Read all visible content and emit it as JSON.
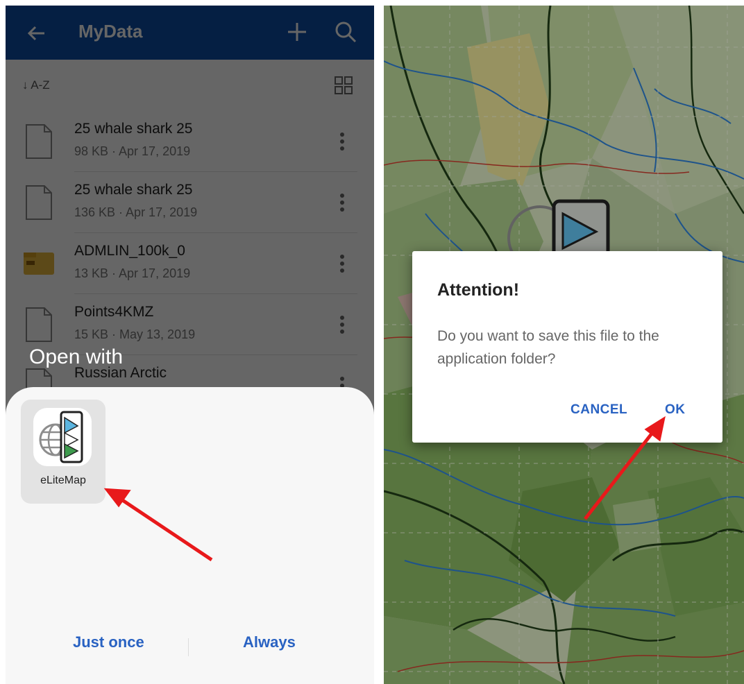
{
  "left": {
    "appbar": {
      "title": "MyData"
    },
    "sort": {
      "label": "A-Z"
    },
    "files": [
      {
        "name": "25 whale shark 25",
        "meta": "98 KB · Apr 17, 2019",
        "type": "doc"
      },
      {
        "name": "25 whale shark 25",
        "meta": "136 KB · Apr 17, 2019",
        "type": "doc"
      },
      {
        "name": "ADMLIN_100k_0",
        "meta": "13 KB · Apr 17, 2019",
        "type": "zip"
      },
      {
        "name": "Points4KMZ",
        "meta": "15 KB · May 13, 2019",
        "type": "doc"
      },
      {
        "name": "Russian Arctic",
        "meta": "",
        "type": "doc"
      }
    ],
    "open_with": "Open with",
    "app": {
      "label": "eLiteMap"
    },
    "buttons": {
      "just_once": "Just once",
      "always": "Always"
    }
  },
  "right": {
    "dialog": {
      "title": "Attention!",
      "message": "Do you want to save this file to the application folder?",
      "cancel": "CANCEL",
      "ok": "OK"
    }
  },
  "colors": {
    "appbar": "#0d4fa8",
    "accent": "#2962c2",
    "arrow": "#e8191b",
    "map_green": "#6f9a4a",
    "map_blue": "#2b78c7",
    "map_red": "#c0392b"
  },
  "icons": [
    "back-arrow-icon",
    "plus-icon",
    "search-icon",
    "sort-arrow-icon",
    "grid-view-icon",
    "file-icon",
    "zip-icon",
    "more-vert-icon",
    "elitemap-app-icon"
  ]
}
